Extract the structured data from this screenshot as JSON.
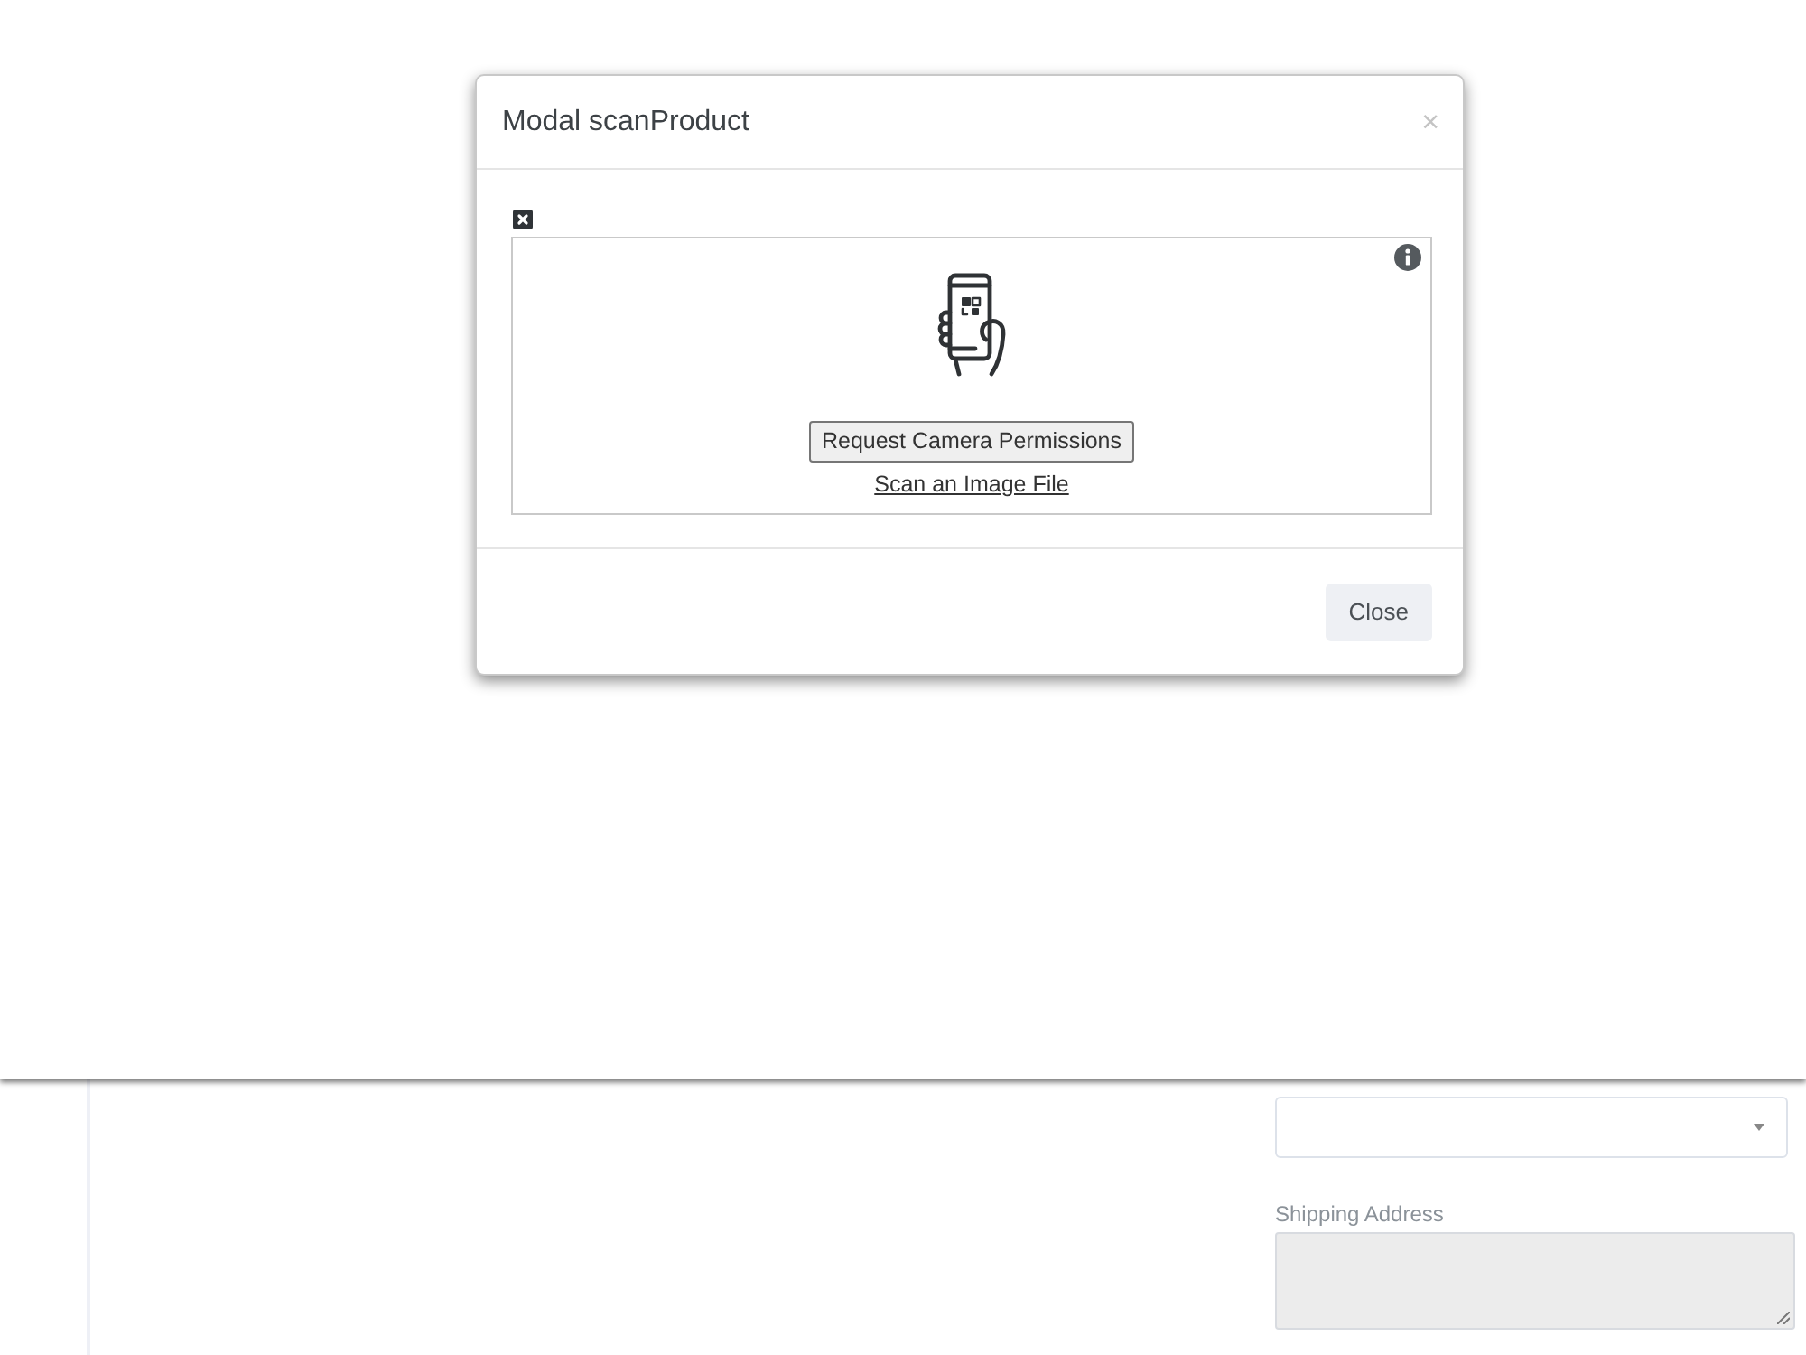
{
  "modal": {
    "title": "Modal scanProduct",
    "close_symbol": "×",
    "scanner": {
      "permission_button": "Request Camera Permissions",
      "file_link": "Scan an Image File"
    },
    "footer_buttons": [
      {
        "label": "Close"
      }
    ]
  },
  "form": {
    "fields": [
      {
        "kind": "select"
      },
      {
        "kind": "textarea",
        "label": "Shipping Address"
      }
    ]
  }
}
